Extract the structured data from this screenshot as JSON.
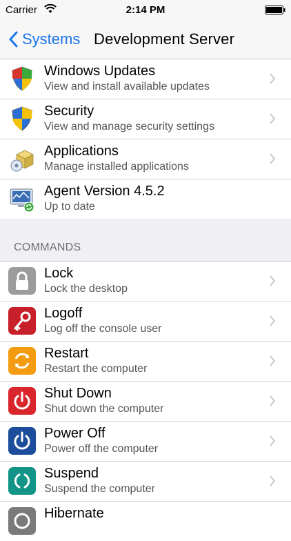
{
  "status_bar": {
    "carrier": "Carrier",
    "time": "2:14 PM"
  },
  "nav": {
    "back_label": "Systems",
    "title": "Development Server"
  },
  "system_items": [
    {
      "title": "Windows Updates",
      "subtitle": "View and install available updates",
      "icon": "windows-updates-shield-icon",
      "chevron": true
    },
    {
      "title": "Security",
      "subtitle": "View and manage security settings",
      "icon": "security-shield-icon",
      "chevron": true
    },
    {
      "title": "Applications",
      "subtitle": "Manage installed applications",
      "icon": "applications-icon",
      "chevron": true
    },
    {
      "title": "Agent Version 4.5.2",
      "subtitle": "Up to date",
      "icon": "agent-monitor-icon",
      "chevron": false
    }
  ],
  "commands_header": "COMMANDS",
  "commands": [
    {
      "title": "Lock",
      "subtitle": "Lock the desktop",
      "icon": "lock-icon",
      "color": "#9b9b9b"
    },
    {
      "title": "Logoff",
      "subtitle": "Log off the console user",
      "icon": "key-icon",
      "color": "#c8202a"
    },
    {
      "title": "Restart",
      "subtitle": "Restart the computer",
      "icon": "restart-icon",
      "color": "#f39c12"
    },
    {
      "title": "Shut Down",
      "subtitle": "Shut down the computer",
      "icon": "power-icon",
      "color": "#d9262c"
    },
    {
      "title": "Power Off",
      "subtitle": "Power off the computer",
      "icon": "power-icon",
      "color": "#1c4e9c"
    },
    {
      "title": "Suspend",
      "subtitle": "Suspend the computer",
      "icon": "suspend-icon",
      "color": "#129488"
    },
    {
      "title": "Hibernate",
      "subtitle": "",
      "icon": "hibernate-icon",
      "color": "#7a7a7a"
    }
  ]
}
